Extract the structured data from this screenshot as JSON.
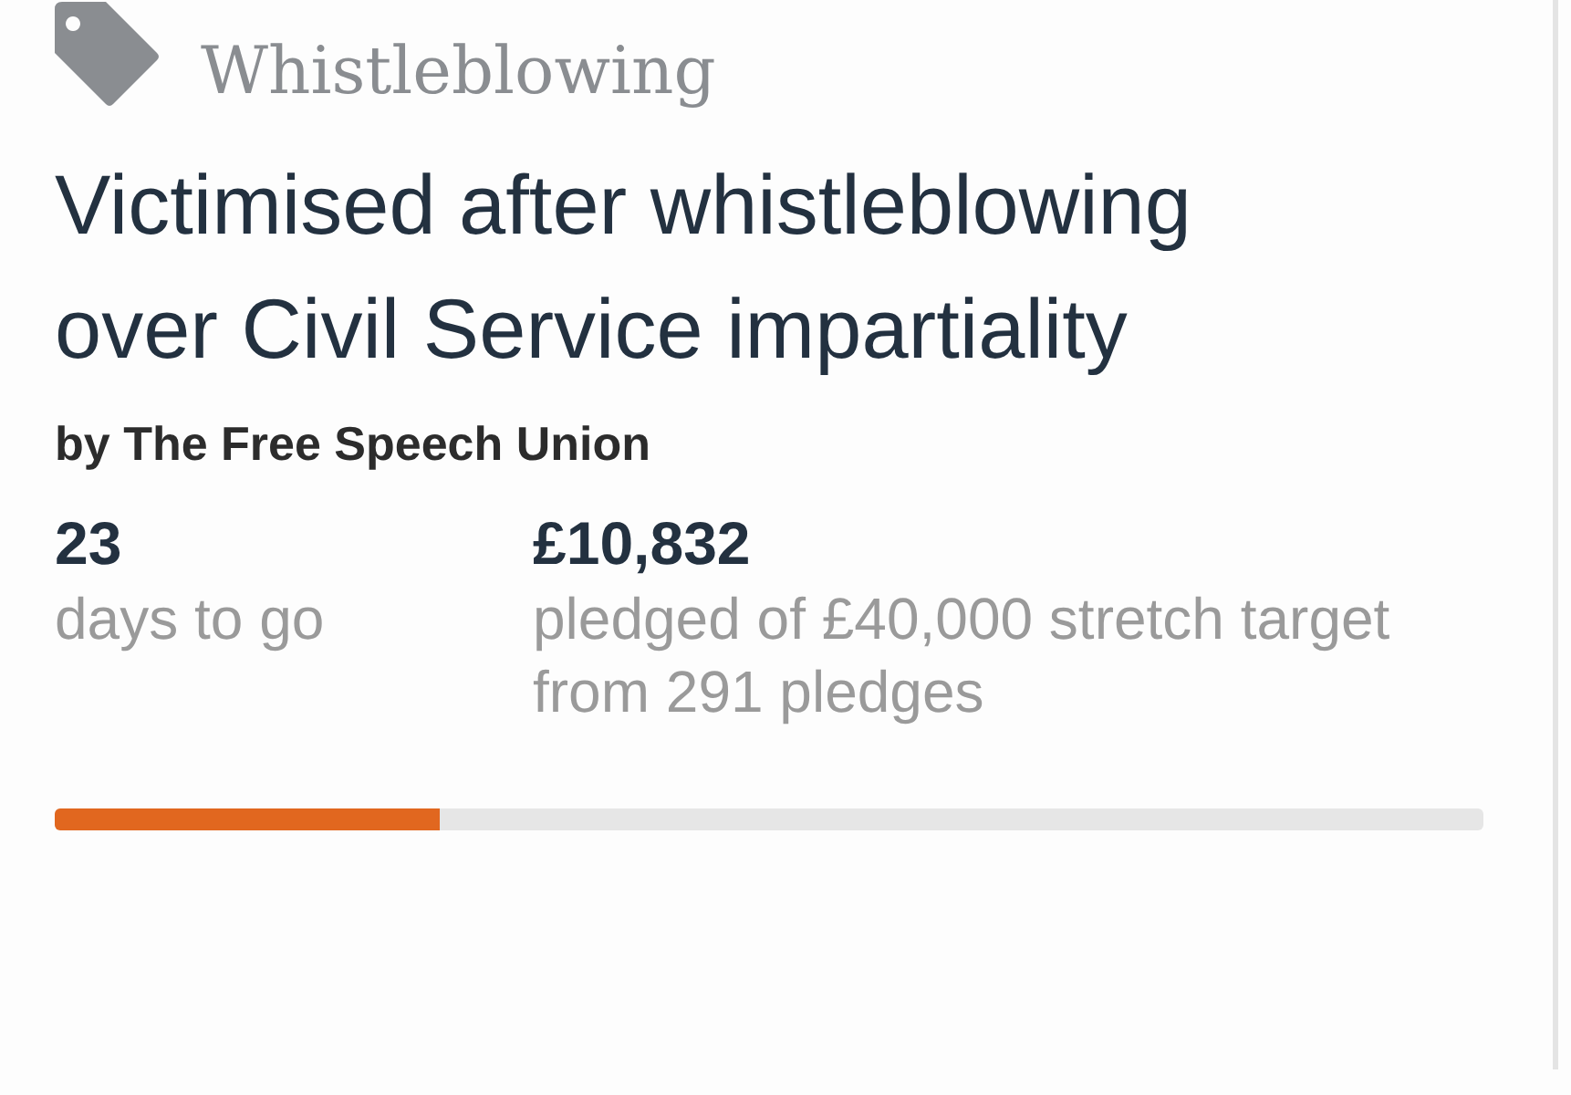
{
  "category": {
    "label": "Whistleblowing"
  },
  "title": "Victimised after whistleblowing over Civil Service impartiality",
  "byline": "by The Free Speech Union",
  "stats": [
    {
      "value": "23",
      "caption": "days to go"
    },
    {
      "value": "£10,832",
      "caption": "pledged of £40,000 stretch target from 291 pledges"
    }
  ],
  "progress": {
    "level": 0.27
  }
}
